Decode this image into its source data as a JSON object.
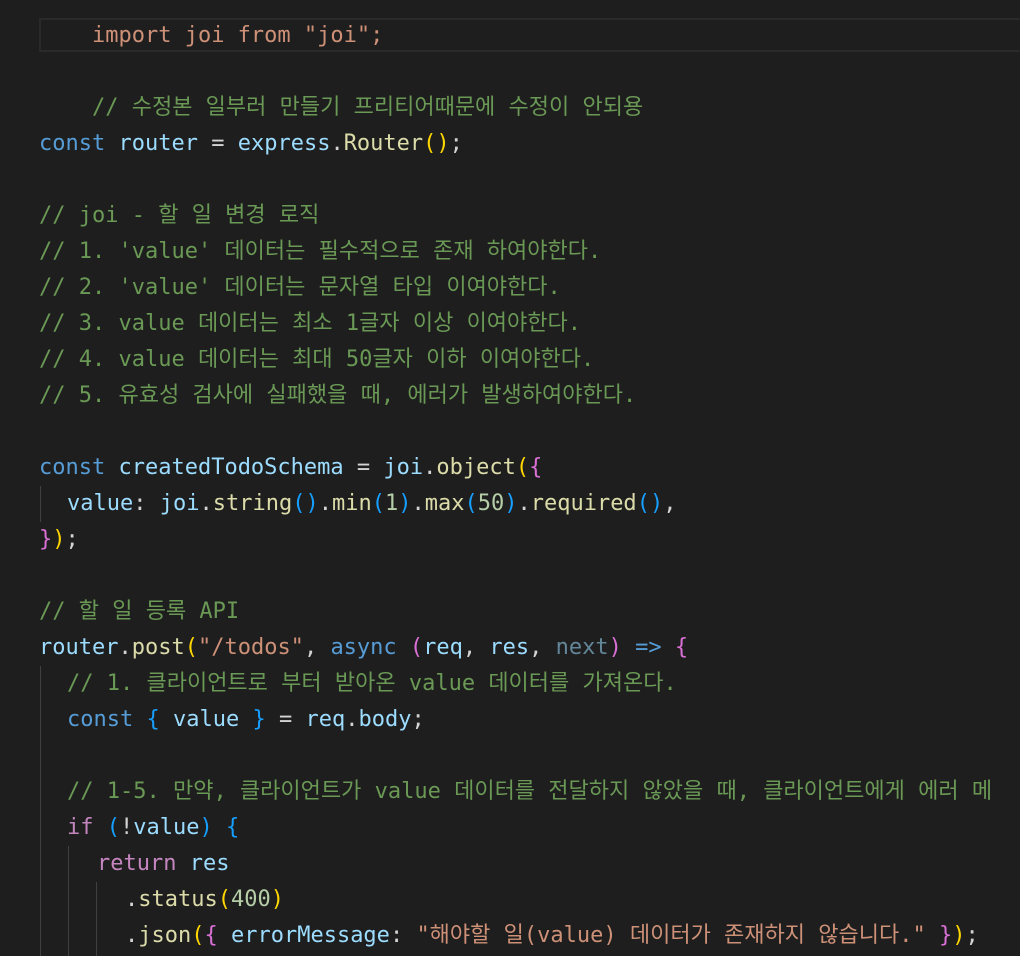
{
  "editor": {
    "theme_background": "#1e1e1e",
    "lines": {
      "l0": [
        "import joi from \"joi\";"
      ],
      "l1": [
        "// 수정본 일부러 만들기 프리티어때문에 수정이 안되용"
      ],
      "l2": [
        "const",
        " ",
        "router",
        " = ",
        "express",
        ".",
        "Router",
        "(",
        ")",
        ";"
      ],
      "l3": [
        "// joi - 할 일 변경 로직"
      ],
      "l4": [
        "// 1. 'value' 데이터는 필수적으로 존재 하여야한다."
      ],
      "l5": [
        "// 2. 'value' 데이터는 문자열 타입 이여야한다."
      ],
      "l6": [
        "// 3. value 데이터는 최소 1글자 이상 이여야한다."
      ],
      "l7": [
        "// 4. value 데이터는 최대 50글자 이하 이여야한다."
      ],
      "l8": [
        "// 5. 유효성 검사에 실패했을 때, 에러가 발생하여야한다."
      ],
      "l9": [
        "const",
        " ",
        "createdTodoSchema",
        " = ",
        "joi",
        ".",
        "object",
        "(",
        "{"
      ],
      "l10": [
        "value",
        ": ",
        "joi",
        ".",
        "string",
        "(",
        ")",
        ".",
        "min",
        "(",
        "1",
        ")",
        ".",
        "max",
        "(",
        "50",
        ")",
        ".",
        "required",
        "(",
        ")",
        ","
      ],
      "l11": [
        "}",
        ")",
        ";"
      ],
      "l12": [
        "// 할 일 등록 API"
      ],
      "l13": [
        "router",
        ".",
        "post",
        "(",
        "\"/todos\"",
        ", ",
        "async",
        " ",
        "(",
        "req",
        ", ",
        "res",
        ", ",
        "next",
        ")",
        " ",
        "=>",
        " ",
        "{"
      ],
      "l14": [
        "// 1. 클라이언트로 부터 받아온 value 데이터를 가져온다."
      ],
      "l15": [
        "const",
        " ",
        "{",
        " ",
        "value",
        " ",
        "}",
        " = ",
        "req",
        ".",
        "body",
        ";"
      ],
      "l16": [
        "// 1-5. 만약, 클라이언트가 value 데이터를 전달하지 않았을 때, 클라이언트에게 에러 메"
      ],
      "l17": [
        "if",
        " ",
        "(",
        "!",
        "value",
        ")",
        " ",
        "{"
      ],
      "l18": [
        "return",
        " ",
        "res"
      ],
      "l19": [
        ".",
        "status",
        "(",
        "400",
        ")"
      ],
      "l20": [
        ".",
        "json",
        "(",
        "{",
        " ",
        "errorMessage",
        ": ",
        "\"해야할 일(value) 데이터가 존재하지 않습니다.\"",
        " ",
        "}",
        ")",
        ";"
      ]
    }
  }
}
